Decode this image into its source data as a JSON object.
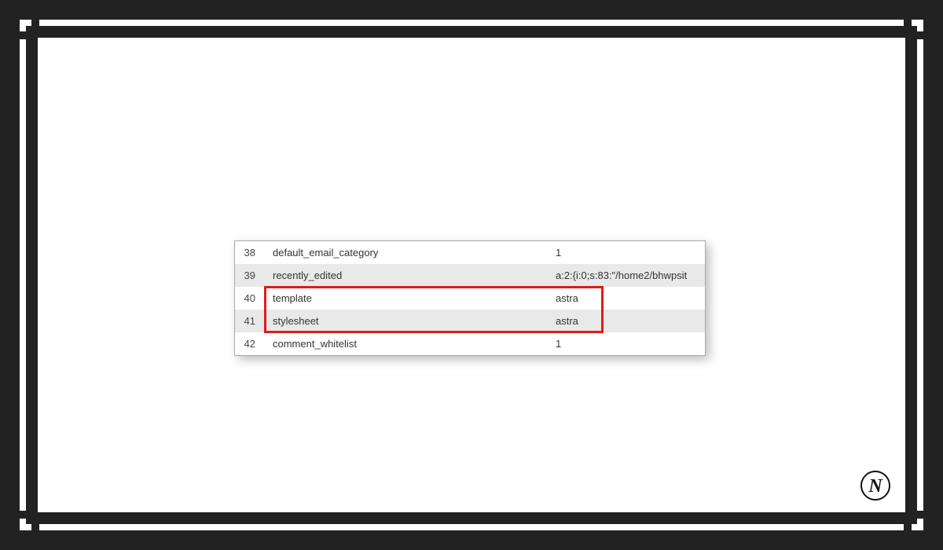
{
  "logo_letter": "N",
  "highlight": {
    "covers_rows": [
      "template",
      "stylesheet"
    ],
    "color": "#e11b1b"
  },
  "table": {
    "rows": [
      {
        "index": "38",
        "name": "default_email_category",
        "value": "1",
        "shaded": false
      },
      {
        "index": "39",
        "name": "recently_edited",
        "value": "a:2:{i:0;s:83:\"/home2/bhwpsit",
        "shaded": true
      },
      {
        "index": "40",
        "name": "template",
        "value": "astra",
        "shaded": false
      },
      {
        "index": "41",
        "name": "stylesheet",
        "value": "astra",
        "shaded": true
      },
      {
        "index": "42",
        "name": "comment_whitelist",
        "value": "1",
        "shaded": false
      }
    ]
  }
}
